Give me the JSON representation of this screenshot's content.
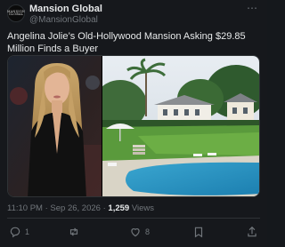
{
  "account": {
    "name": "Mansion Global",
    "handle": "@MansionGlobal",
    "avatar_text": "MANSION GLOBAL"
  },
  "tweet": {
    "text": "Angelina Jolie’s Old-Hollywood Mansion Asking $29.85 Million Finds a Buyer",
    "time": "11:10 PM",
    "date": "Sep 26, 2026",
    "views_count": "1,259",
    "views_label": "Views"
  },
  "actions": {
    "reply_count": "1",
    "retweet_count": "",
    "like_count": "8",
    "bookmark_count": ""
  },
  "colors": {
    "background": "#16181c",
    "text": "#e7e9ea",
    "muted": "#71767b",
    "border": "#2f3336"
  }
}
